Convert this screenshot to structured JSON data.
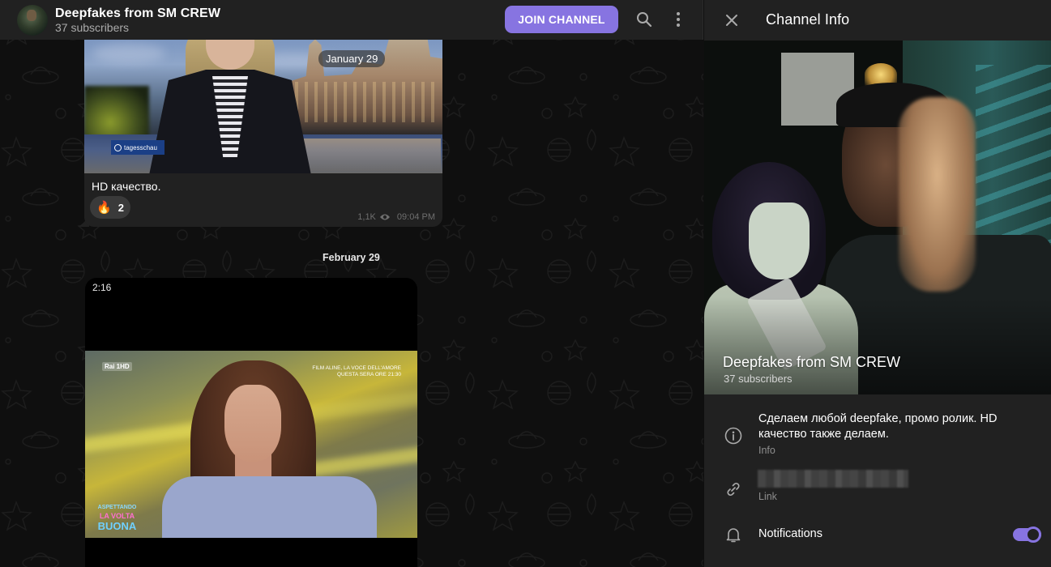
{
  "chat": {
    "header": {
      "title": "Deepfakes from SM CREW",
      "subtitle": "37 subscribers",
      "join_button": "JOIN CHANNEL",
      "search_icon": "search-icon",
      "more_icon": "more-vertical-icon"
    },
    "messages": [
      {
        "type": "video",
        "floating_date": "January 29",
        "media_overlay": "tagesschau",
        "caption": "HD качество.",
        "reactions": [
          {
            "emoji": "🔥",
            "count": "2"
          }
        ],
        "views": "1,1K",
        "time": "09:04 PM"
      },
      {
        "type": "video",
        "date_separator": "February 29",
        "duration": "2:16",
        "media_overlay": {
          "channel_logo": "Rai 1HD",
          "ticker_line1": "FILM ALINE, LA VOCE DELL'AMORE",
          "ticker_line2": "QUESTA SERA ORE 21:30",
          "show_logo": [
            "ASPETTANDO",
            "LA VOLTA",
            "BUONA"
          ]
        }
      }
    ]
  },
  "panel": {
    "title": "Channel Info",
    "close_icon": "close-icon",
    "profile": {
      "name": "Deepfakes from SM CREW",
      "subscribers": "37 subscribers"
    },
    "info": {
      "text": "Сделаем любой deepfake, промо ролик. HD качество также делаем.",
      "label": "Info"
    },
    "link": {
      "value_redacted": true,
      "label": "Link"
    },
    "notifications": {
      "label": "Notifications",
      "enabled": true
    }
  },
  "colors": {
    "accent": "#8774e1",
    "panel_bg": "#212121",
    "chat_bg": "#0f0f0f",
    "secondary_text": "#aaaaaa"
  }
}
